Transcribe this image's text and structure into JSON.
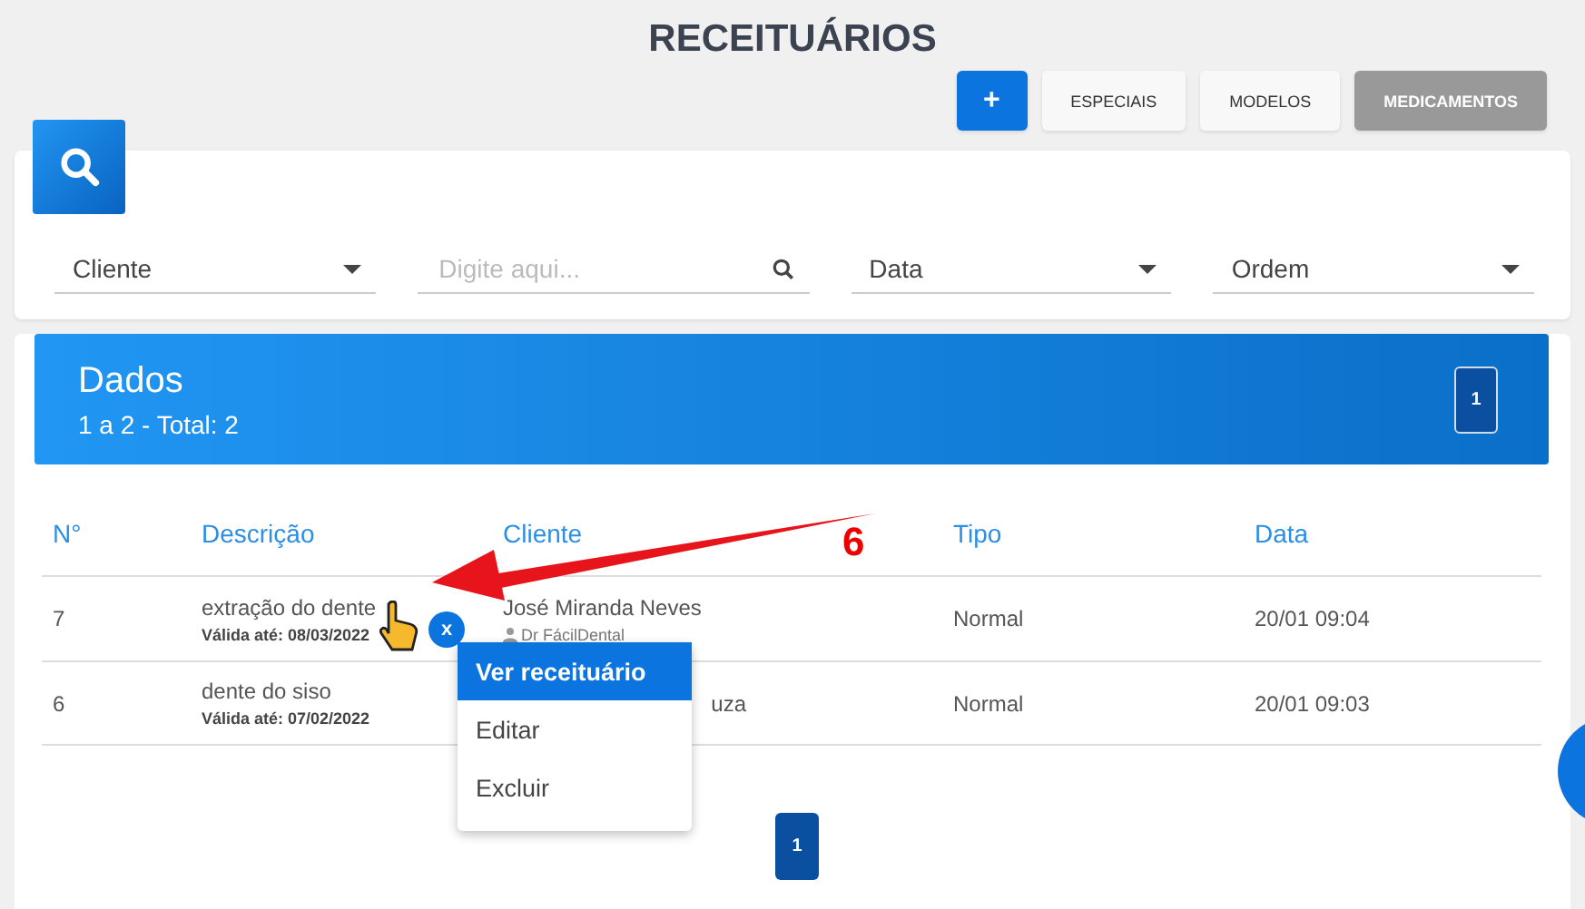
{
  "title": "RECEITUÁRIOS",
  "actions": [
    {
      "kind": "add",
      "label": "+",
      "selected": false
    },
    {
      "kind": "tab",
      "label": "ESPECIAIS",
      "selected": false
    },
    {
      "kind": "tab",
      "label": "MODELOS",
      "selected": false
    },
    {
      "kind": "tab",
      "label": "MEDICAMENTOS",
      "selected": true
    }
  ],
  "filters": [
    {
      "kind": "select",
      "label": "Cliente"
    },
    {
      "kind": "search",
      "placeholder": "Digite aqui..."
    },
    {
      "kind": "select",
      "label": "Data"
    },
    {
      "kind": "select",
      "label": "Ordem"
    }
  ],
  "data_header": {
    "title": "Dados",
    "subtitle": "1 a 2 - Total: 2",
    "page": "1"
  },
  "table": {
    "columns": [
      "N°",
      "Descrição",
      "Cliente",
      "Tipo",
      "Data"
    ],
    "rows": [
      {
        "number": "7",
        "description": "extração do dente",
        "valid": "Válida até: 08/03/2022",
        "client": "José Miranda Neves",
        "dentist": "Dr FácilDental",
        "type": "Normal",
        "date": "20/01 09:04"
      },
      {
        "number": "6",
        "description": "dente do siso",
        "valid": "Válida até: 07/02/2022",
        "client": "uza",
        "type": "Normal",
        "date": "20/01 09:03"
      }
    ]
  },
  "close_badge": "x",
  "menu": [
    {
      "label": "Ver receituário",
      "selected": true
    },
    {
      "label": "Editar",
      "selected": false
    },
    {
      "label": "Excluir",
      "selected": false
    }
  ],
  "pagination": [
    {
      "label": "1",
      "selected": true
    }
  ],
  "annotation": "6"
}
